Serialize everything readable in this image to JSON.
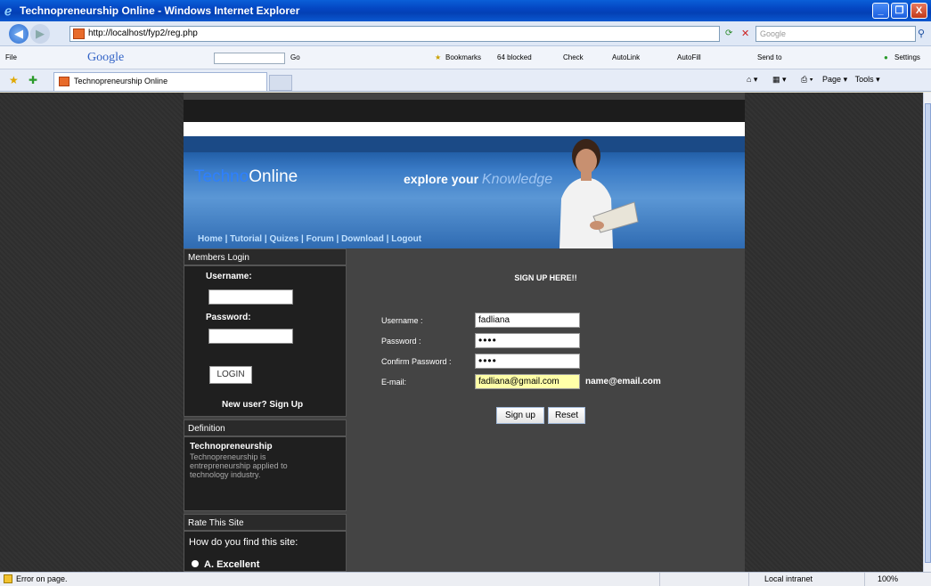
{
  "window": {
    "title": "Technopreneurship Online - Windows Internet Explorer",
    "minimize": "_",
    "maximize": "❐",
    "close": "X"
  },
  "address_bar": {
    "url": "http://localhost/fyp2/reg.php",
    "search_placeholder": "Google"
  },
  "google_toolbar": {
    "file_menu": "File",
    "brand": "Google",
    "go": "Go",
    "bookmarks": "Bookmarks",
    "blocked": "64 blocked",
    "check": "Check",
    "autolink": "AutoLink",
    "autofill": "AutoFill",
    "send_to": "Send to",
    "settings": "Settings"
  },
  "tabs": [
    {
      "label": "Technopreneurship Online"
    }
  ],
  "command_bar": {
    "page": "Page",
    "tools": "Tools"
  },
  "site": {
    "logo_techno": "Techno",
    "logo_online": "Online",
    "slogan_prefix": "explore your ",
    "slogan_emphasis": "Knowledge",
    "nav": [
      "Home",
      "Tutorial",
      "Quizes",
      "Forum",
      "Download",
      "Logout"
    ]
  },
  "members_login": {
    "heading": "Members Login",
    "username_label": "Username:",
    "password_label": "Password:",
    "login_button": "LOGIN",
    "new_user_text": "New user?",
    "sign_up_link": "Sign Up"
  },
  "definition": {
    "heading": "Definition",
    "term": "Technopreneurship",
    "text": "Technopreneurship is entrepreneurship applied to technology industry."
  },
  "rate": {
    "heading": "Rate This Site",
    "question": "How do you find this site:",
    "option_letter": "A.",
    "option_text": "Excellent"
  },
  "signup": {
    "heading": "SIGN UP HERE!!",
    "username_label": "Username :",
    "username_value": "fadliana",
    "password_label": "Password :",
    "password_value": "••••",
    "confirm_label": "Confirm Password :",
    "confirm_value": "••••",
    "email_label": "E-mail:",
    "email_value": "fadliana@gmail.com",
    "email_hint": "name@email.com",
    "signup_button": "Sign up",
    "reset_button": "Reset"
  },
  "status_bar": {
    "message": "Error on page.",
    "zone": "Local intranet",
    "zoom": "100%"
  }
}
